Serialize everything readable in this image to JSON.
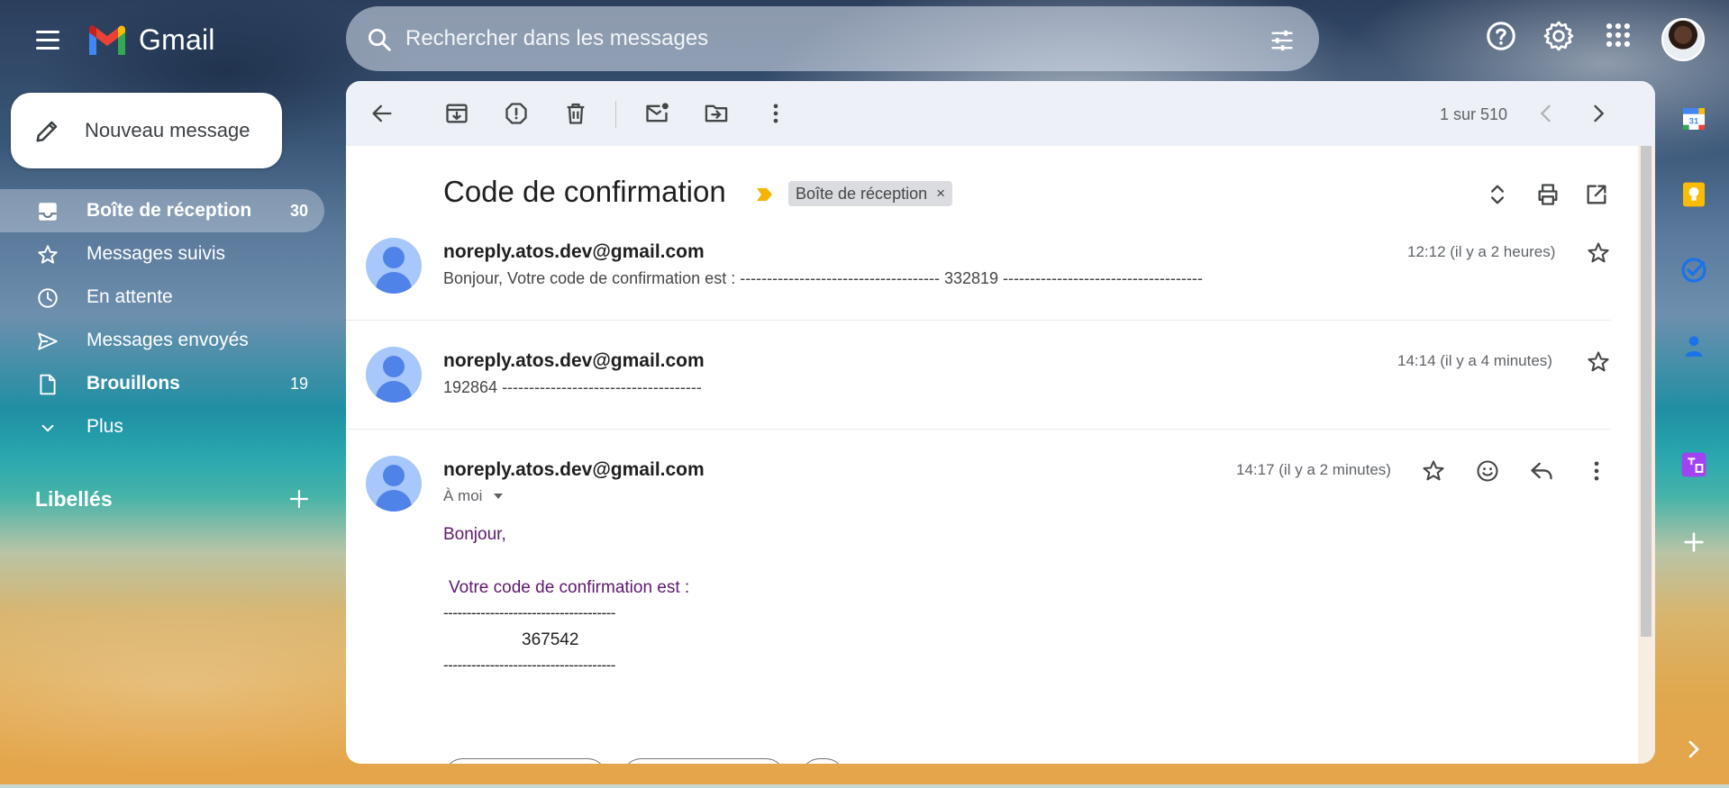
{
  "app": {
    "name": "Gmail"
  },
  "search": {
    "placeholder": "Rechercher dans les messages"
  },
  "compose": {
    "label": "Nouveau message"
  },
  "nav": {
    "items": [
      {
        "label": "Boîte de réception",
        "count": "30",
        "active": true,
        "icon": "inbox-icon"
      },
      {
        "label": "Messages suivis",
        "count": "",
        "icon": "star-icon"
      },
      {
        "label": "En attente",
        "count": "",
        "icon": "clock-icon"
      },
      {
        "label": "Messages envoyés",
        "count": "",
        "icon": "send-icon"
      },
      {
        "label": "Brouillons",
        "count": "19",
        "icon": "draft-icon"
      },
      {
        "label": "Plus",
        "count": "",
        "icon": "chevron-down-icon"
      }
    ]
  },
  "labels": {
    "title": "Libellés"
  },
  "toolbar": {
    "pager": "1 sur 510"
  },
  "thread": {
    "subject": "Code de confirmation",
    "label_chip": "Boîte de réception",
    "chip_close": "×",
    "messages": [
      {
        "sender": "noreply.atos.dev@gmail.com",
        "time": "12:12 (il y a 2 heures)",
        "snippet": "Bonjour, Votre code de confirmation est : ------------------------------------- 332819 -------------------------------------"
      },
      {
        "sender": "noreply.atos.dev@gmail.com",
        "time": "14:14 (il y a 4 minutes)",
        "snippet": "192864 -------------------------------------"
      },
      {
        "sender": "noreply.atos.dev@gmail.com",
        "time": "14:17 (il y a 2 minutes)",
        "recipient": "À moi",
        "body": {
          "greeting": "Bonjour,",
          "line": "Votre code de confirmation est :",
          "dashes": "-------------------------------------",
          "code": "367542"
        }
      }
    ]
  },
  "colors": {
    "accent": "#0b57d0",
    "body_text": "#5b1a6b",
    "importance": "#f4b400"
  }
}
